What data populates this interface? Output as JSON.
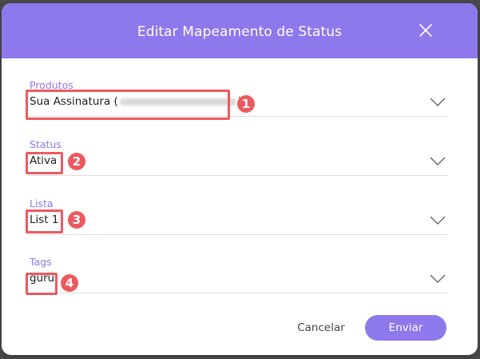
{
  "modal": {
    "title": "Editar Mapeamento de Status",
    "close_icon": "close-icon"
  },
  "fields": [
    {
      "label": "Produtos",
      "value_prefix": "Sua Assinatura (",
      "value_suffix": ")",
      "value_redacted": true,
      "annotation": "1"
    },
    {
      "label": "Status",
      "value": "Ativa",
      "annotation": "2"
    },
    {
      "label": "Lista",
      "value": "List 1",
      "annotation": "3"
    },
    {
      "label": "Tags",
      "value": "guru",
      "annotation": "4"
    }
  ],
  "actions": {
    "cancel_label": "Cancelar",
    "submit_label": "Enviar"
  },
  "colors": {
    "accent": "#8d78ec",
    "highlight": "#ec5a5f",
    "overlay": "#4a4a4c"
  },
  "icons": [
    "close-icon",
    "chevron-down-icon"
  ]
}
